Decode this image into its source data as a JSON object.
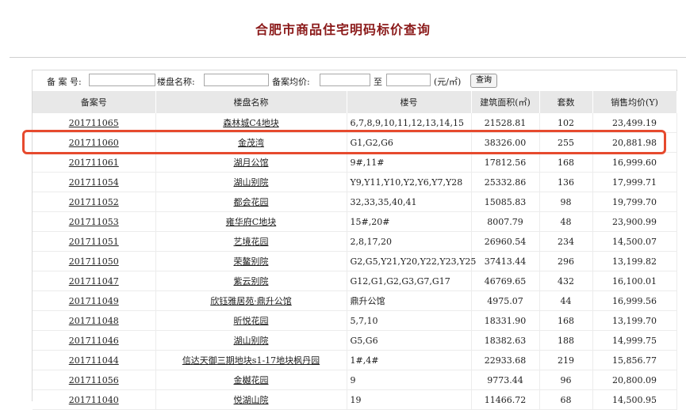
{
  "page": {
    "title": "合肥市商品住宅明码标价查询"
  },
  "search": {
    "record_no_label": "备 案 号:",
    "project_name_label": "楼盘名称:",
    "avg_price_label": "备案均价:",
    "to_label": "至",
    "unit_label": "(元/㎡)",
    "query_button": "查询"
  },
  "table": {
    "headers": [
      "备案号",
      "楼盘名称",
      "楼号",
      "建筑面积(㎡)",
      "套数",
      "销售均价(Y)"
    ],
    "rows": [
      {
        "record_no": "201711065",
        "project": "森林城C4地块",
        "buildings": "6,7,8,9,10,11,12,13,14,15",
        "area": "21528.81",
        "units": "102",
        "avg_price": "23,499.19"
      },
      {
        "record_no": "201711060",
        "project": "金茂湾",
        "buildings": "G1,G2,G6",
        "area": "38326.00",
        "units": "255",
        "avg_price": "20,881.98"
      },
      {
        "record_no": "201711061",
        "project": "湖月公馆",
        "buildings": "9#,11#",
        "area": "17812.56",
        "units": "168",
        "avg_price": "16,999.60"
      },
      {
        "record_no": "201711054",
        "project": "湖山别院",
        "buildings": "Y9,Y11,Y10,Y2,Y6,Y7,Y28",
        "area": "25332.86",
        "units": "136",
        "avg_price": "17,999.71"
      },
      {
        "record_no": "201711052",
        "project": "都会花园",
        "buildings": "32,33,35,40,41",
        "area": "15085.83",
        "units": "98",
        "avg_price": "19,799.70"
      },
      {
        "record_no": "201711053",
        "project": "雍华府C地块",
        "buildings": "15#,20#",
        "area": "8007.79",
        "units": "48",
        "avg_price": "23,900.99"
      },
      {
        "record_no": "201711051",
        "project": "艺境花园",
        "buildings": "2,8,17,20",
        "area": "26960.54",
        "units": "234",
        "avg_price": "14,500.07"
      },
      {
        "record_no": "201711050",
        "project": "荣鳌别院",
        "buildings": "G2,G5,Y21,Y20,Y22,Y23,Y25",
        "area": "37413.44",
        "units": "296",
        "avg_price": "13,199.82"
      },
      {
        "record_no": "201711047",
        "project": "紫云别院",
        "buildings": "G12,G1,G2,G3,G7,G17",
        "area": "46769.65",
        "units": "432",
        "avg_price": "16,100.01"
      },
      {
        "record_no": "201711049",
        "project": "欣钰雅居苑·鼎升公馆",
        "buildings": "鼎升公馆",
        "area": "4975.07",
        "units": "44",
        "avg_price": "16,999.56"
      },
      {
        "record_no": "201711048",
        "project": "昕悦花园",
        "buildings": "5,7,10",
        "area": "18331.90",
        "units": "168",
        "avg_price": "13,199.70"
      },
      {
        "record_no": "201711046",
        "project": "湖山别院",
        "buildings": "G5,G6",
        "area": "18382.63",
        "units": "188",
        "avg_price": "14,999.75"
      },
      {
        "record_no": "201711044",
        "project": "信达天御三期地块s1-17地块枫丹园",
        "buildings": "1#,4#",
        "area": "22933.68",
        "units": "219",
        "avg_price": "15,856.77"
      },
      {
        "record_no": "201711056",
        "project": "金樾花园",
        "buildings": "9",
        "area": "9773.44",
        "units": "96",
        "avg_price": "20,800.09"
      },
      {
        "record_no": "201711040",
        "project": "悦湖山院",
        "buildings": "19",
        "area": "11466.72",
        "units": "68",
        "avg_price": "14,500.95"
      }
    ]
  },
  "highlight_color": "#e64a2e",
  "title_color": "#8b1a1a"
}
